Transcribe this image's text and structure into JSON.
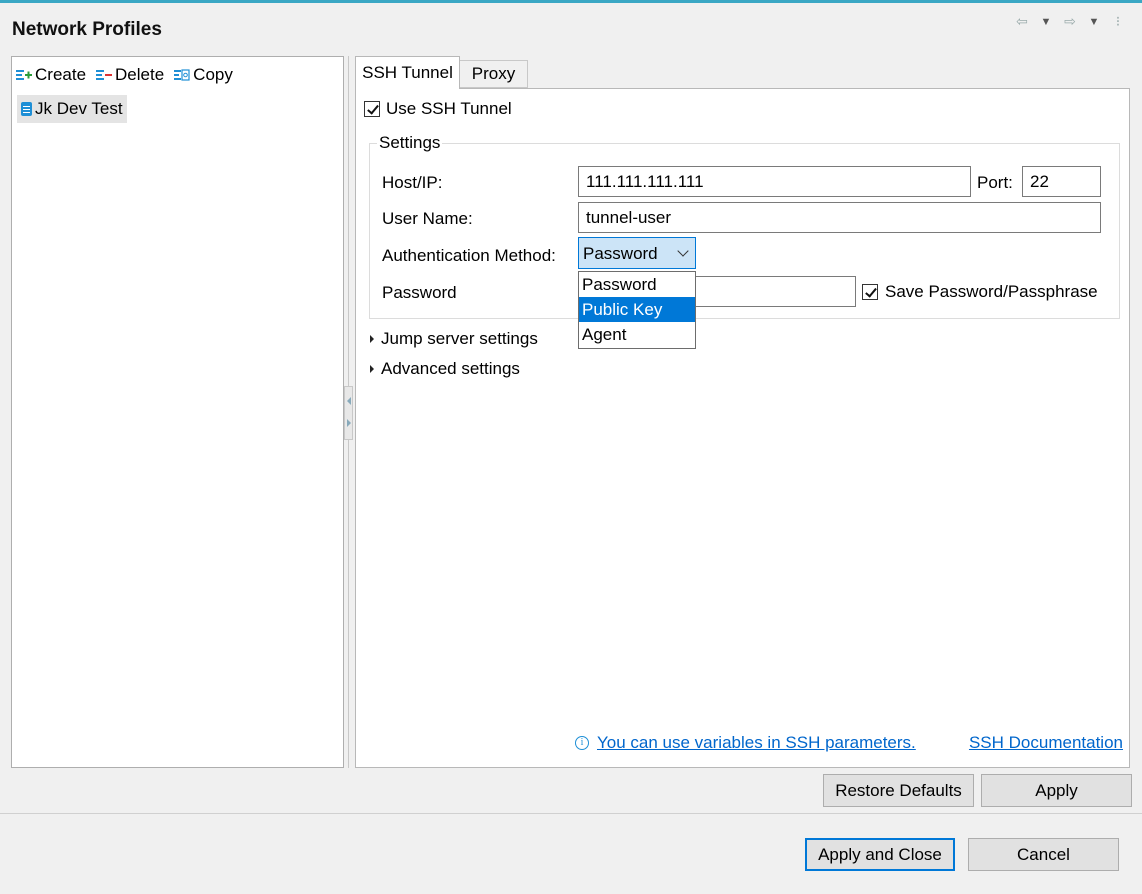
{
  "window": {
    "title": "Network Profiles"
  },
  "toolbar": {
    "create": "Create",
    "delete": "Delete",
    "copy": "Copy"
  },
  "profiles": [
    {
      "label": "Jk Dev Test"
    }
  ],
  "tabs": [
    {
      "label": "SSH Tunnel",
      "active": true
    },
    {
      "label": "Proxy",
      "active": false
    }
  ],
  "ssh": {
    "use_label": "Use SSH Tunnel",
    "use_checked": true,
    "settings_title": "Settings",
    "host_label": "Host/IP:",
    "host_value": "111.111.111.111",
    "port_label": "Port:",
    "port_value": "22",
    "user_label": "User Name:",
    "user_value": "tunnel-user",
    "auth_label": "Authentication Method:",
    "auth_selected": "Password",
    "auth_options": [
      "Password",
      "Public Key",
      "Agent"
    ],
    "auth_highlighted": "Public Key",
    "password_label": "Password",
    "password_value": "",
    "save_password_label": "Save Password/Passphrase",
    "save_password_checked": true,
    "jump_label": "Jump server settings",
    "advanced_label": "Advanced settings",
    "variables_link": "You can use variables in SSH parameters.",
    "docs_link": "SSH Documentation"
  },
  "buttons": {
    "restore_defaults": "Restore Defaults",
    "apply": "Apply",
    "apply_close": "Apply and Close",
    "cancel": "Cancel"
  },
  "colors": {
    "accent": "#0078d7",
    "link": "#0066cc",
    "topline": "#3aa7c4"
  }
}
